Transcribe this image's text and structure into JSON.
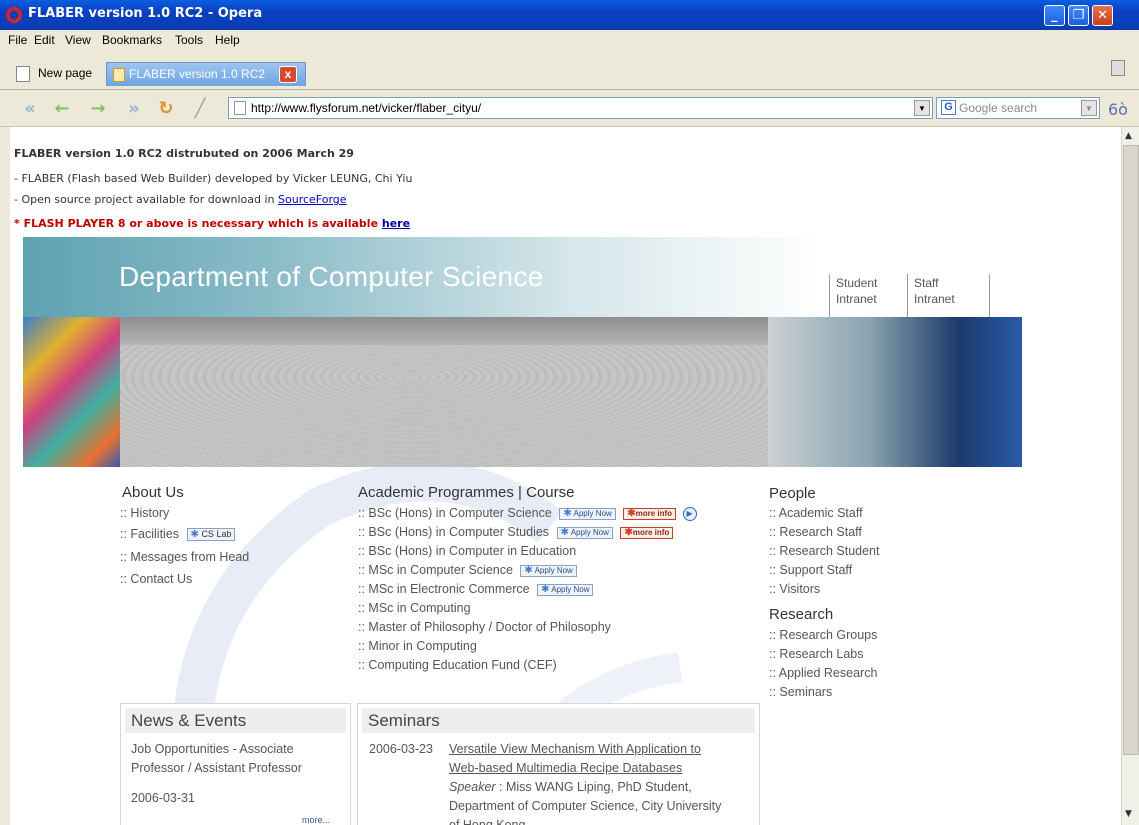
{
  "window": {
    "title": "FLABER version 1.0 RC2 - Opera"
  },
  "menu": [
    "File",
    "Edit",
    "View",
    "Bookmarks",
    "Tools",
    "Help"
  ],
  "tabs": {
    "new_page": "New page",
    "active": "FLABER version 1.0 RC2"
  },
  "address": {
    "url": "http://www.flysforum.net/vicker/flaber_cityu/",
    "search_placeholder": "Google search"
  },
  "intro": {
    "headline": "FLABER version 1.0 RC2 distrubuted on 2006 March 29",
    "line1": "- FLABER (Flash based Web Builder) developed by Vicker LEUNG, Chi Yiu",
    "line2_prefix": "- Open source project available for download in ",
    "line2_link": "SourceForge",
    "warning_prefix": "* FLASH PLAYER 8 or above is necessary which is available ",
    "warning_link": "here"
  },
  "banner": {
    "title": "Department of Computer Science",
    "student_l1": "Student",
    "student_l2": "Intranet",
    "staff_l1": "Staff",
    "staff_l2": "Intranet"
  },
  "about": {
    "title": "About Us",
    "items": [
      ":: History",
      ":: Facilities",
      ":: Messages from Head",
      ":: Contact Us"
    ],
    "cs_lab": "CS Lab"
  },
  "academic": {
    "title": "Academic Programmes | Course",
    "items": [
      ":: BSc (Hons) in Computer Science",
      ":: BSc (Hons) in Computer Studies",
      ":: BSc (Hons) in Computer in Education",
      ":: MSc in Computer Science",
      ":: MSc in  Electronic Commerce",
      ":: MSc in Computing",
      ":: Master of Philosophy / Doctor of Philosophy",
      ":: Minor in Computing",
      ":: Computing Education Fund (CEF)"
    ],
    "apply_now": "Apply Now",
    "more_info": "more info"
  },
  "people": {
    "title": "People",
    "items": [
      ":: Academic Staff",
      ":: Research Staff",
      ":: Research Student",
      ":: Support Staff",
      ":: Visitors"
    ]
  },
  "research": {
    "title": "Research",
    "items": [
      ":: Research Groups",
      ":: Research Labs",
      ":: Applied Research",
      ":: Seminars"
    ]
  },
  "news": {
    "title": "News & Events",
    "line1": "Job Opportunities - Associate",
    "line2": "Professor / Assistant Professor",
    "date": "2006-03-31",
    "more": "more..."
  },
  "seminars": {
    "title": "Seminars",
    "date": "2006-03-23",
    "line1": "Versatile View Mechanism With Application to",
    "line2": "Web-based Multimedia Recipe Databases",
    "speaker_label": "Speaker",
    "speaker": " : Miss WANG Liping, PhD Student,",
    "line4": "Department of Computer Science, City University",
    "line5": "of Hong Kong"
  }
}
